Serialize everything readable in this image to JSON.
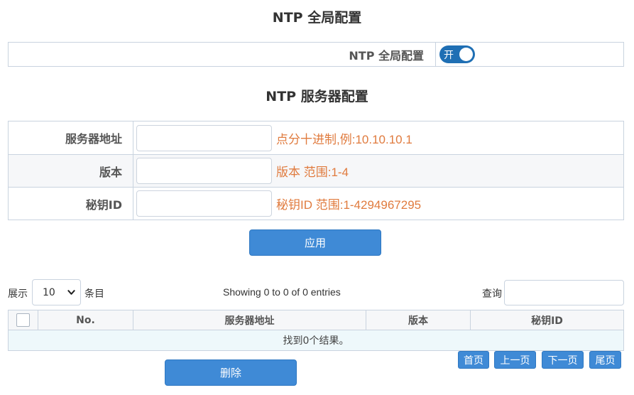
{
  "global_section": {
    "title": "NTP 全局配置",
    "label": "NTP 全局配置",
    "toggle_text": "开",
    "enabled": true
  },
  "server_section": {
    "title": "NTP 服务器配置",
    "fields": [
      {
        "label": "服务器地址",
        "value": "",
        "hint": "点分十进制,例:10.10.10.1"
      },
      {
        "label": "版本",
        "value": "",
        "hint": "版本 范围:1-4"
      },
      {
        "label": "秘钥ID",
        "value": "",
        "hint": "秘钥ID 范围:1-4294967295"
      }
    ],
    "apply_label": "应用"
  },
  "table_controls": {
    "show_label": "展示",
    "page_size": "10",
    "entries_label": "条目",
    "showing_text": "Showing 0 to 0 of 0 entries",
    "search_label": "查询",
    "search_value": ""
  },
  "table": {
    "columns": [
      "No.",
      "服务器地址",
      "版本",
      "秘钥ID"
    ],
    "empty_text": "找到0个结果。"
  },
  "pagination": {
    "first": "首页",
    "prev": "上一页",
    "next": "下一页",
    "last": "尾页"
  },
  "delete_label": "删除"
}
